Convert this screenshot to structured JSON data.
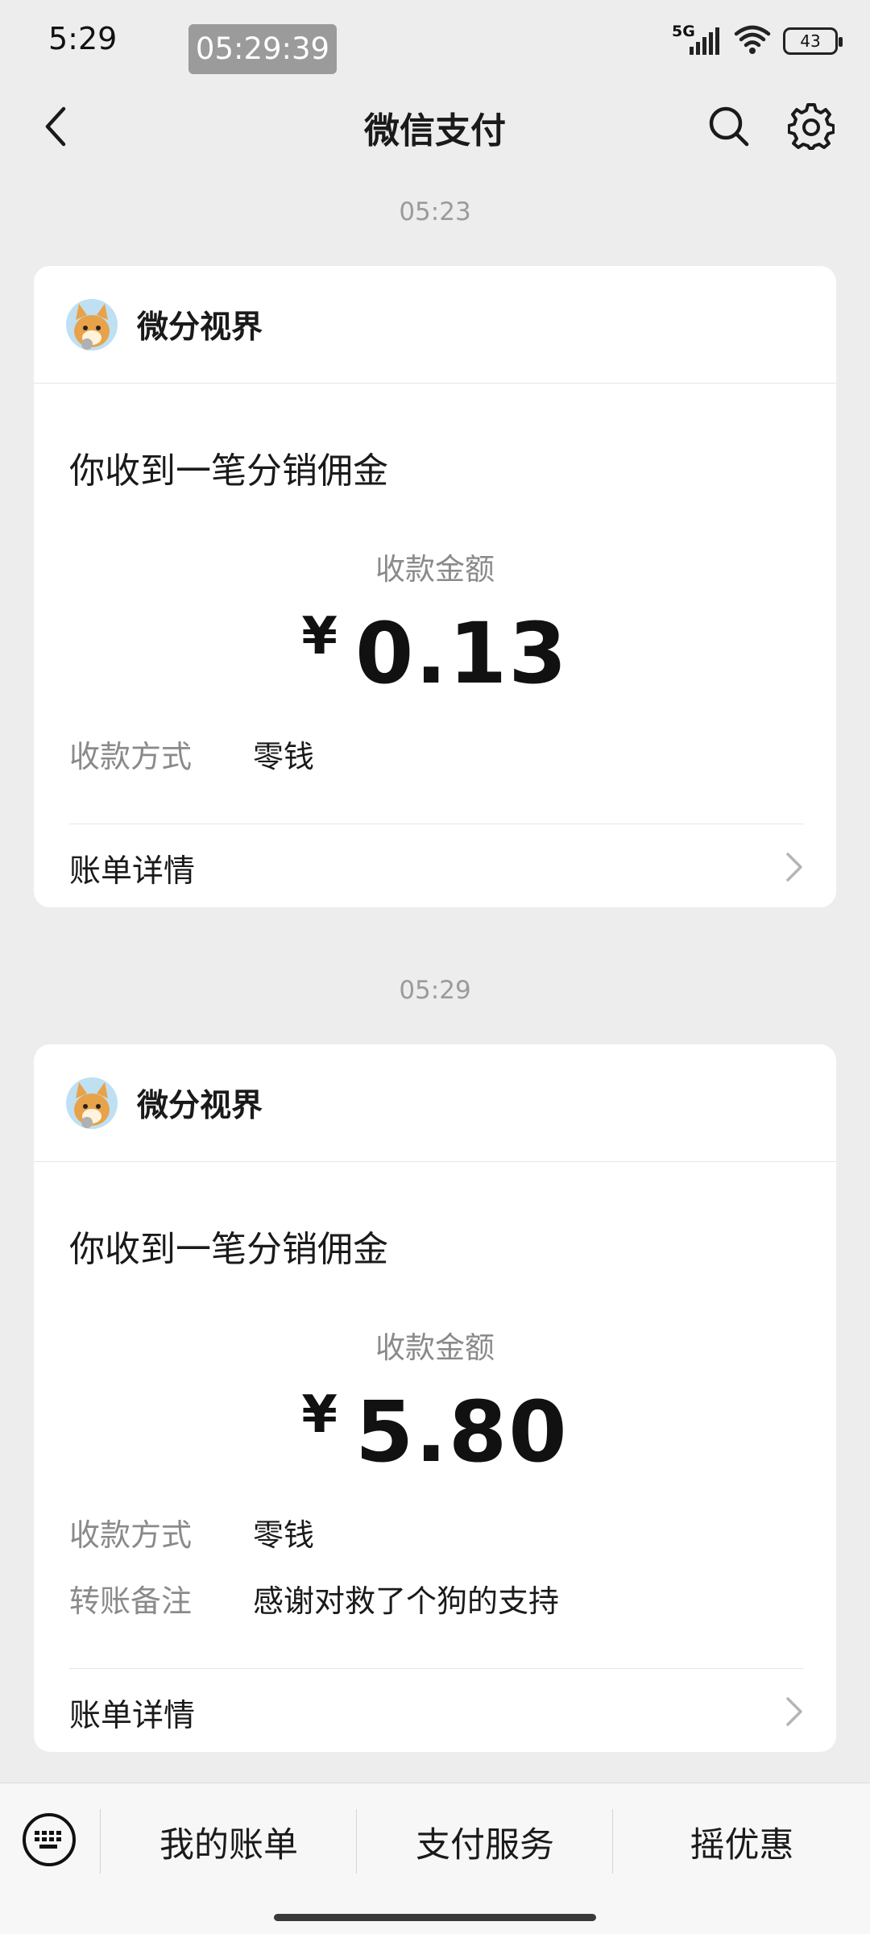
{
  "status_bar": {
    "time": "5:29",
    "clock_badge": "05:29:39",
    "network": "5G",
    "battery": "43"
  },
  "nav": {
    "title": "微信支付"
  },
  "messages": [
    {
      "timestamp": "05:23",
      "sender": "微分视界",
      "title": "你收到一笔分销佣金",
      "amount_label": "收款金额",
      "currency": "¥",
      "amount": "0.13",
      "fields": [
        {
          "key": "收款方式",
          "value": "零钱"
        }
      ],
      "detail_label": "账单详情"
    },
    {
      "timestamp": "05:29",
      "sender": "微分视界",
      "title": "你收到一笔分销佣金",
      "amount_label": "收款金额",
      "currency": "¥",
      "amount": "5.80",
      "fields": [
        {
          "key": "收款方式",
          "value": "零钱"
        },
        {
          "key": "转账备注",
          "value": "感谢对救了个狗的支持"
        }
      ],
      "detail_label": "账单详情"
    }
  ],
  "bottom_menu": {
    "items": [
      "我的账单",
      "支付服务",
      "摇优惠"
    ]
  },
  "icons": {
    "back": "chevron-left-icon",
    "search": "search-icon",
    "settings": "gear-icon",
    "keyboard": "keyboard-icon",
    "detail": "chevron-right-icon"
  }
}
